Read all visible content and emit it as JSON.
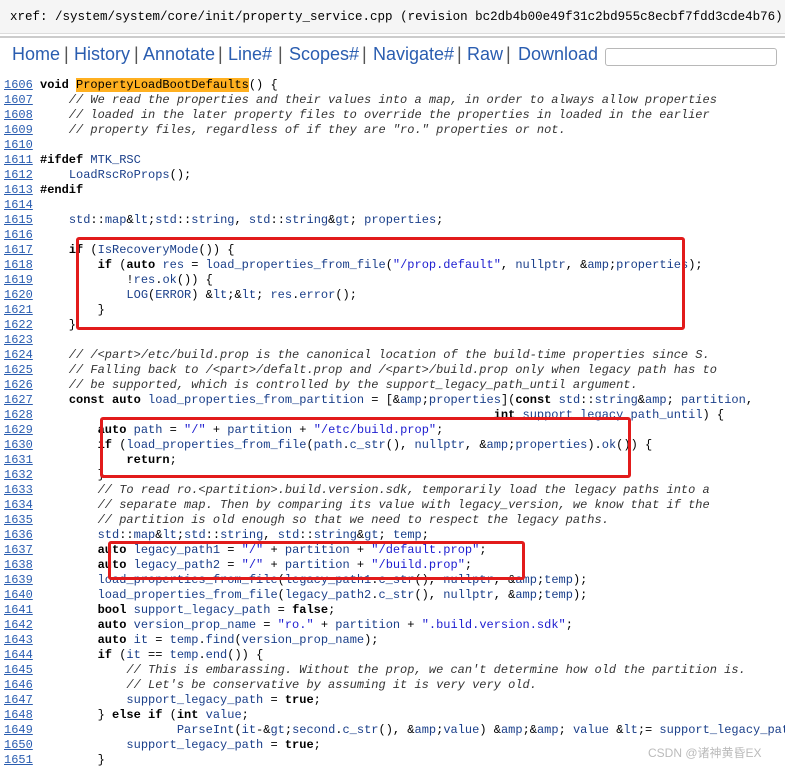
{
  "xref": {
    "label": "xref: /system/system/core/init/property_service.cpp (revision bc2db4b00e49f31c2bd955c8ecbf7fdd3cde4b76)"
  },
  "nav": {
    "items": [
      "Home",
      "History",
      "Annotate",
      "Line#",
      "Scopes#",
      "Navigate#",
      "Raw",
      "Download"
    ],
    "separator": "|",
    "search_value": ""
  },
  "code": {
    "lines": [
      {
        "n": "1606",
        "t": "void PropertyLoadBootDefaults() {"
      },
      {
        "n": "1607",
        "t": "    // We read the properties and their values into a map, in order to always allow properties"
      },
      {
        "n": "1608",
        "t": "    // loaded in the later property files to override the properties in loaded in the earlier"
      },
      {
        "n": "1609",
        "t": "    // property files, regardless of if they are \"ro.\" properties or not."
      },
      {
        "n": "1610",
        "t": ""
      },
      {
        "n": "1611",
        "t": "#ifdef MTK_RSC"
      },
      {
        "n": "1612",
        "t": "    LoadRscRoProps();"
      },
      {
        "n": "1613",
        "t": "#endif"
      },
      {
        "n": "1614",
        "t": ""
      },
      {
        "n": "1615",
        "t": "    std::map<std::string, std::string> properties;"
      },
      {
        "n": "1616",
        "t": ""
      },
      {
        "n": "1617",
        "t": "    if (IsRecoveryMode()) {"
      },
      {
        "n": "1618",
        "t": "        if (auto res = load_properties_from_file(\"/prop.default\", nullptr, &properties);"
      },
      {
        "n": "1619",
        "t": "            !res.ok()) {"
      },
      {
        "n": "1620",
        "t": "            LOG(ERROR) << res.error();"
      },
      {
        "n": "1621",
        "t": "        }"
      },
      {
        "n": "1622",
        "t": "    }"
      },
      {
        "n": "1623",
        "t": ""
      },
      {
        "n": "1624",
        "t": "    // /<part>/etc/build.prop is the canonical location of the build-time properties since S."
      },
      {
        "n": "1625",
        "t": "    // Falling back to /<part>/defalt.prop and /<part>/build.prop only when legacy path has to"
      },
      {
        "n": "1626",
        "t": "    // be supported, which is controlled by the support_legacy_path_until argument."
      },
      {
        "n": "1627",
        "t": "    const auto load_properties_from_partition = [&properties](const std::string& partition,"
      },
      {
        "n": "1628",
        "t": "                                                               int support_legacy_path_until) {"
      },
      {
        "n": "1629",
        "t": "        auto path = \"/\" + partition + \"/etc/build.prop\";"
      },
      {
        "n": "1630",
        "t": "        if (load_properties_from_file(path.c_str(), nullptr, &properties).ok()) {"
      },
      {
        "n": "1631",
        "t": "            return;"
      },
      {
        "n": "1632",
        "t": "        }"
      },
      {
        "n": "1633",
        "t": "        // To read ro.<partition>.build.version.sdk, temporarily load the legacy paths into a"
      },
      {
        "n": "1634",
        "t": "        // separate map. Then by comparing its value with legacy_version, we know that if the"
      },
      {
        "n": "1635",
        "t": "        // partition is old enough so that we need to respect the legacy paths."
      },
      {
        "n": "1636",
        "t": "        std::map<std::string, std::string> temp;"
      },
      {
        "n": "1637",
        "t": "        auto legacy_path1 = \"/\" + partition + \"/default.prop\";"
      },
      {
        "n": "1638",
        "t": "        auto legacy_path2 = \"/\" + partition + \"/build.prop\";"
      },
      {
        "n": "1639",
        "t": "        load_properties_from_file(legacy_path1.c_str(), nullptr, &temp);"
      },
      {
        "n": "1640",
        "t": "        load_properties_from_file(legacy_path2.c_str(), nullptr, &temp);"
      },
      {
        "n": "1641",
        "t": "        bool support_legacy_path = false;"
      },
      {
        "n": "1642",
        "t": "        auto version_prop_name = \"ro.\" + partition + \".build.version.sdk\";"
      },
      {
        "n": "1643",
        "t": "        auto it = temp.find(version_prop_name);"
      },
      {
        "n": "1644",
        "t": "        if (it == temp.end()) {"
      },
      {
        "n": "1645",
        "t": "            // This is embarassing. Without the prop, we can't determine how old the partition is."
      },
      {
        "n": "1646",
        "t": "            // Let's be conservative by assuming it is very very old."
      },
      {
        "n": "1647",
        "t": "            support_legacy_path = true;"
      },
      {
        "n": "1648",
        "t": "        } else if (int value;"
      },
      {
        "n": "1649",
        "t": "                   ParseInt(it->second.c_str(), &value) && value <= support_legacy_path_until) {"
      },
      {
        "n": "1650",
        "t": "            support_legacy_path = true;"
      },
      {
        "n": "1651",
        "t": "        }"
      }
    ]
  },
  "watermark": "CSDN @诸神黄昏EX",
  "colors": {
    "link": "#2a5db0",
    "highlight_box": "#e21b1b",
    "function_highlight": "#ffb020"
  }
}
